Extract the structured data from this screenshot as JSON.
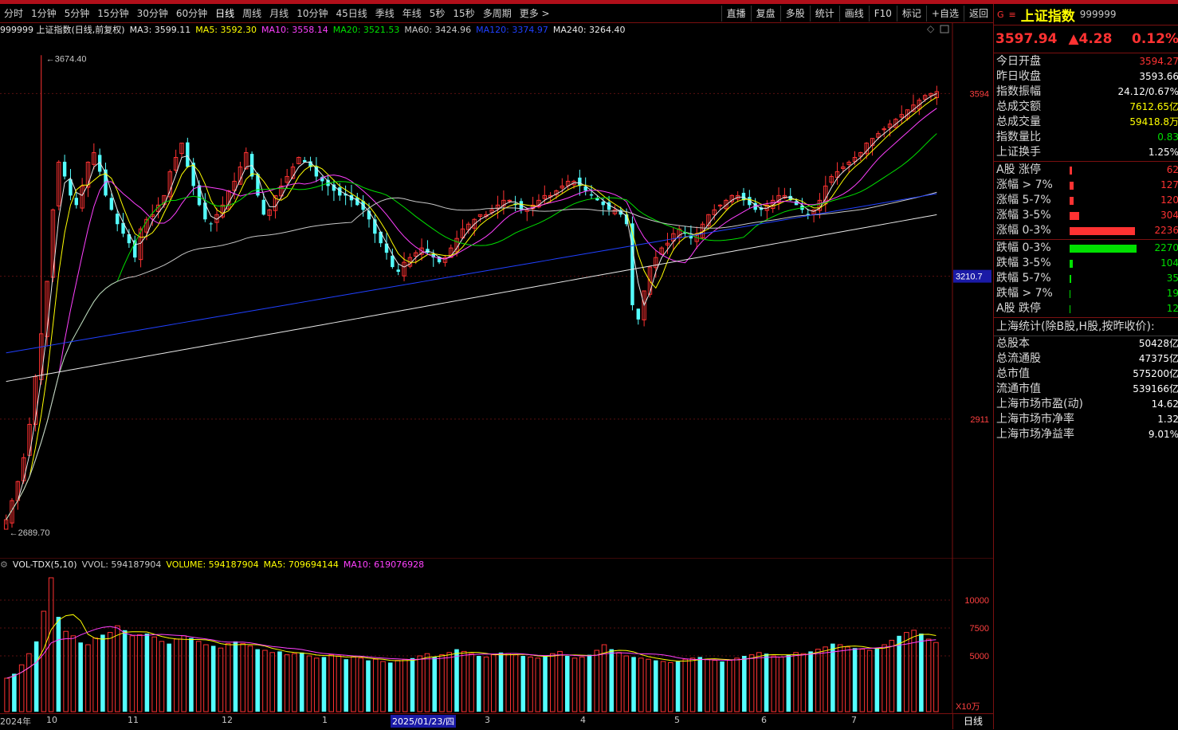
{
  "toolbar": {
    "periods": [
      "分时",
      "1分钟",
      "5分钟",
      "15分钟",
      "30分钟",
      "60分钟",
      "日线",
      "周线",
      "月线",
      "10分钟",
      "45日线",
      "季线",
      "年线",
      "5秒",
      "15秒",
      "多周期",
      "更多 >"
    ],
    "active_period": "日线",
    "tools": [
      "直播",
      "复盘",
      "多股",
      "统计",
      "画线",
      "F10",
      "标记",
      "+自选",
      "返回"
    ]
  },
  "main_legend": {
    "title": "999999 上证指数(日线,前复权)",
    "items": [
      {
        "label": "MA3: 3599.11",
        "color": "#e8e8e8"
      },
      {
        "label": "MA5: 3592.30",
        "color": "#ffff00"
      },
      {
        "label": "MA10: 3558.14",
        "color": "#ff40ff"
      },
      {
        "label": "MA20: 3521.53",
        "color": "#00e000"
      },
      {
        "label": "MA60: 3424.96",
        "color": "#c8c8c8"
      },
      {
        "label": "MA120: 3374.97",
        "color": "#2040ff"
      },
      {
        "label": "MA240: 3264.40",
        "color": "#e8e8e8"
      }
    ]
  },
  "vol_legend": {
    "title": "VOL-TDX(5,10)",
    "items": [
      {
        "label": "VVOL: 594187904",
        "color": "#c8c8c8"
      },
      {
        "label": "VOLUME: 594187904",
        "color": "#ffff00"
      },
      {
        "label": "MA5: 709694144",
        "color": "#ffff00"
      },
      {
        "label": "MA10: 619076928",
        "color": "#ff40ff"
      }
    ]
  },
  "chart_data": {
    "type": "candlestick",
    "title": "上证指数 日线",
    "price_axis_ticks": [
      3594,
      3210.7,
      2911
    ],
    "price_axis_range": [
      2660,
      3710
    ],
    "annotations": {
      "high": "3674.40",
      "low": "2689.70",
      "current_marker": "3210.7"
    },
    "x_labels": [
      "2024年",
      "10",
      "11",
      "12",
      "1",
      "2025/01/23/四",
      "3",
      "4",
      "5",
      "6",
      "7"
    ],
    "close_series": [
      2700,
      2740,
      2780,
      2830,
      2900,
      3000,
      3090,
      3200,
      3350,
      3450,
      3420,
      3380,
      3360,
      3400,
      3450,
      3470,
      3430,
      3380,
      3350,
      3320,
      3300,
      3280,
      3250,
      3310,
      3330,
      3340,
      3360,
      3380,
      3430,
      3460,
      3490,
      3440,
      3400,
      3360,
      3330,
      3320,
      3340,
      3360,
      3390,
      3410,
      3440,
      3470,
      3420,
      3380,
      3340,
      3350,
      3380,
      3400,
      3420,
      3440,
      3460,
      3450,
      3440,
      3420,
      3410,
      3400,
      3390,
      3380,
      3380,
      3370,
      3360,
      3350,
      3330,
      3300,
      3280,
      3260,
      3230,
      3220,
      3240,
      3250,
      3260,
      3270,
      3260,
      3250,
      3240,
      3250,
      3270,
      3290,
      3310,
      3320,
      3330,
      3340,
      3340,
      3350,
      3360,
      3370,
      3370,
      3360,
      3350,
      3350,
      3360,
      3370,
      3380,
      3380,
      3390,
      3400,
      3410,
      3410,
      3400,
      3390,
      3380,
      3370,
      3360,
      3350,
      3350,
      3340,
      3320,
      3150,
      3120,
      3180,
      3230,
      3250,
      3270,
      3280,
      3300,
      3310,
      3300,
      3290,
      3300,
      3320,
      3340,
      3350,
      3360,
      3370,
      3380,
      3380,
      3370,
      3360,
      3350,
      3350,
      3360,
      3370,
      3380,
      3380,
      3370,
      3360,
      3350,
      3340,
      3350,
      3370,
      3400,
      3420,
      3430,
      3440,
      3450,
      3460,
      3470,
      3490,
      3500,
      3510,
      3520,
      3530,
      3540,
      3550,
      3560,
      3570,
      3580,
      3590,
      3594,
      3598
    ],
    "volume_axis_ticks": [
      10000,
      7500,
      5000
    ],
    "volume_unit": "X10万",
    "volume_series": [
      3000,
      3400,
      4200,
      5200,
      6300,
      9000,
      12000,
      8500,
      7200,
      6800,
      6200,
      6000,
      6600,
      6900,
      7100,
      7700,
      7300,
      6800,
      6900,
      7000,
      6700,
      6300,
      6100,
      6500,
      6800,
      6600,
      6300,
      6000,
      5900,
      5700,
      6100,
      6300,
      6100,
      5900,
      5600,
      5500,
      5300,
      5400,
      5100,
      5200,
      5300,
      5000,
      4800,
      4900,
      5100,
      5000,
      4700,
      4900,
      4800,
      4600,
      4700,
      4500,
      4400,
      4600,
      4700,
      4800,
      5000,
      5200,
      4900,
      5100,
      5300,
      5600,
      5400,
      5200,
      5000,
      4900,
      5100,
      5300,
      5200,
      5100,
      5000,
      4900,
      4800,
      5000,
      5200,
      5400,
      5000,
      4800,
      4900,
      5100,
      5500,
      6000,
      5600,
      5300,
      5000,
      4900,
      4800,
      4700,
      4600,
      4500,
      4400,
      4500,
      4700,
      4800,
      4900,
      4700,
      4600,
      4500,
      4600,
      4800,
      5000,
      5100,
      5300,
      5200,
      5000,
      4900,
      5100,
      5300,
      5200,
      5400,
      5600,
      5800,
      6100,
      6000,
      5800,
      5700,
      5600,
      5500,
      5700,
      6000,
      6400,
      6800,
      7100,
      7300,
      7000,
      6500,
      6200
    ]
  },
  "side": {
    "g": "G",
    "menu": "≡",
    "name": "上证指数",
    "code": "999999",
    "price": "3597.94",
    "change": "▲4.28",
    "pct": "0.12%",
    "info": [
      {
        "k": "今日开盘",
        "v": "3594.27",
        "c": "#ff3232"
      },
      {
        "k": "昨日收盘",
        "v": "3593.66",
        "c": "#ffffff"
      },
      {
        "k": "指数振幅",
        "v": "24.12/0.67%",
        "c": "#ffffff"
      },
      {
        "k": "总成交额",
        "v": "7612.65亿",
        "c": "#ffff00"
      },
      {
        "k": "总成交量",
        "v": "59418.8万",
        "c": "#ffff00"
      },
      {
        "k": "指数量比",
        "v": "0.83",
        "c": "#00e000"
      },
      {
        "k": "上证换手",
        "v": "1.25%",
        "c": "#ffffff"
      }
    ],
    "breadth": [
      {
        "k": "A股 涨停",
        "v": "62",
        "c": "#ff3232",
        "bar": 3
      },
      {
        "k": "涨幅 > 7%",
        "v": "127",
        "c": "#ff3232",
        "bar": 5
      },
      {
        "k": "涨幅 5-7%",
        "v": "120",
        "c": "#ff3232",
        "bar": 5
      },
      {
        "k": "涨幅 3-5%",
        "v": "304",
        "c": "#ff3232",
        "bar": 12
      },
      {
        "k": "涨幅 0-3%",
        "v": "2236",
        "c": "#ff3232",
        "bar": 82
      },
      {
        "k": "跌幅 0-3%",
        "v": "2270",
        "c": "#00e000",
        "bar": 84
      },
      {
        "k": "跌幅 3-5%",
        "v": "104",
        "c": "#00e000",
        "bar": 4
      },
      {
        "k": "跌幅 5-7%",
        "v": "35",
        "c": "#00e000",
        "bar": 2
      },
      {
        "k": "跌幅 > 7%",
        "v": "19",
        "c": "#00e000",
        "bar": 1
      },
      {
        "k": "A股 跌停",
        "v": "12",
        "c": "#00e000",
        "bar": 1
      }
    ],
    "stats_title": "上海统计(除B股,H股,按昨收价):",
    "stats": [
      {
        "k": "总股本",
        "v": "50428亿"
      },
      {
        "k": "总流通股",
        "v": "47375亿"
      },
      {
        "k": "总市值",
        "v": "575200亿"
      },
      {
        "k": "流通市值",
        "v": "539166亿"
      },
      {
        "k": "上海市场市盈(动)",
        "v": "14.62"
      },
      {
        "k": "上海市场市净率",
        "v": "1.32"
      },
      {
        "k": "上海市场净益率",
        "v": "9.01%"
      }
    ]
  },
  "x_axis_period": "日线"
}
